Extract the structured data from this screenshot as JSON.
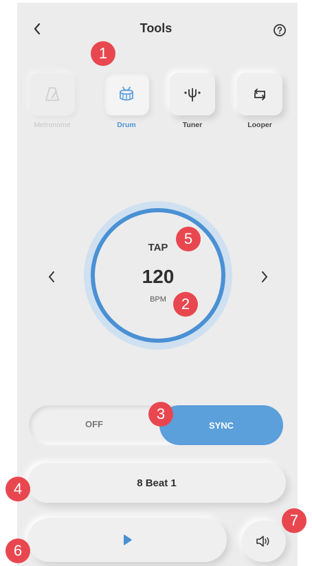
{
  "header": {
    "title": "Tools"
  },
  "tools": [
    {
      "label": "Metronome",
      "icon": "metronome-icon",
      "state": "disabled"
    },
    {
      "label": "Drum",
      "icon": "drum-icon",
      "state": "active"
    },
    {
      "label": "Tuner",
      "icon": "tuner-icon",
      "state": "normal"
    },
    {
      "label": "Looper",
      "icon": "looper-icon",
      "state": "normal"
    }
  ],
  "tempo": {
    "tap_label": "TAP",
    "bpm": "120",
    "unit": "BPM"
  },
  "sync_toggle": {
    "off_label": "OFF",
    "on_label": "SYNC",
    "selected": "SYNC"
  },
  "pattern": {
    "name": "8 Beat 1"
  },
  "markers": [
    "1",
    "2",
    "3",
    "4",
    "5",
    "6",
    "7"
  ],
  "colors": {
    "accent": "#5b9fdb",
    "ring": "#4a90d4",
    "marker": "#e9474f",
    "background": "#ececec"
  }
}
